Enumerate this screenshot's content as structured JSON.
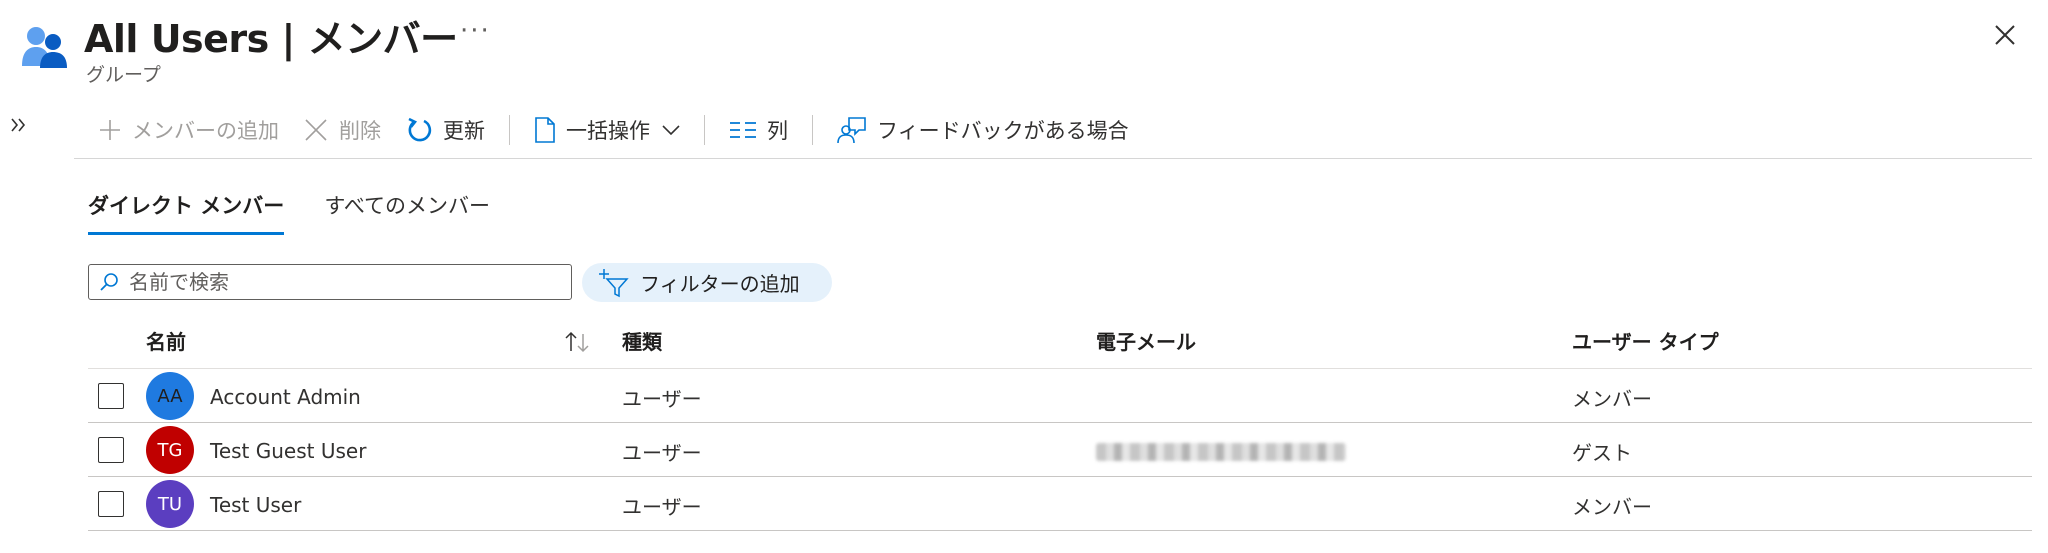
{
  "header": {
    "title": "All Users | メンバー",
    "subtitle": "グループ",
    "more_label": "···"
  },
  "toolbar": {
    "add_member": "メンバーの追加",
    "delete": "削除",
    "refresh": "更新",
    "bulk_ops": "一括操作",
    "columns": "列",
    "feedback": "フィードバックがある場合"
  },
  "tabs": [
    {
      "label": "ダイレクト メンバー",
      "active": true
    },
    {
      "label": "すべてのメンバー",
      "active": false
    }
  ],
  "search": {
    "placeholder": "名前で検索"
  },
  "filter": {
    "label": "フィルターの追加"
  },
  "table": {
    "columns": [
      "名前",
      "種類",
      "電子メール",
      "ユーザー タイプ"
    ],
    "rows": [
      {
        "initials": "AA",
        "name": "Account Admin",
        "type": "ユーザー",
        "email_redacted": false,
        "user_type": "メンバー",
        "avatar_color": "#1f7ae0",
        "initials_color": "#201f1e"
      },
      {
        "initials": "TG",
        "name": "Test Guest User",
        "type": "ユーザー",
        "email_redacted": true,
        "user_type": "ゲスト",
        "avatar_color": "#c00000",
        "initials_color": "#ffffff"
      },
      {
        "initials": "TU",
        "name": "Test User",
        "type": "ユーザー",
        "email_redacted": false,
        "user_type": "メンバー",
        "avatar_color": "#5b3ec0",
        "initials_color": "#ffffff"
      }
    ]
  },
  "icons": {
    "header": "group-users-icon",
    "close": "close-icon",
    "expand": "chevron-double-right-icon",
    "add": "plus-icon",
    "delete": "x-icon",
    "refresh": "refresh-icon",
    "bulk": "document-icon",
    "columns": "columns-icon",
    "feedback": "feedback-person-icon",
    "search": "search-icon",
    "filter": "filter-add-icon",
    "sort": "sort-arrows-icon"
  },
  "colors": {
    "accent": "#0078d4",
    "filter_pill_bg": "#e5f1fb",
    "disabled_text": "#a19f9d"
  }
}
